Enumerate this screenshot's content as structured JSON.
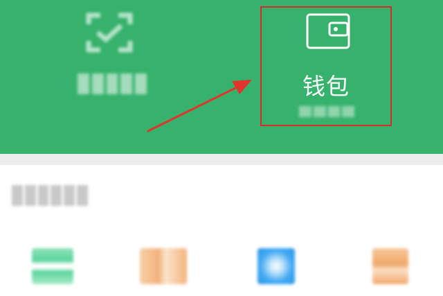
{
  "header": {
    "wallet_label": "钱包"
  },
  "icons": {
    "scan": "scan-icon",
    "wallet": "wallet-icon"
  },
  "colors": {
    "header_bg": "#36b26c",
    "highlight_border": "#d82b2b",
    "arrow": "#e0342d",
    "shortcut_1": "#5bd49a",
    "shortcut_2": "#f2b37d",
    "shortcut_3": "#42a9f2",
    "shortcut_4": "#f1a86a"
  }
}
